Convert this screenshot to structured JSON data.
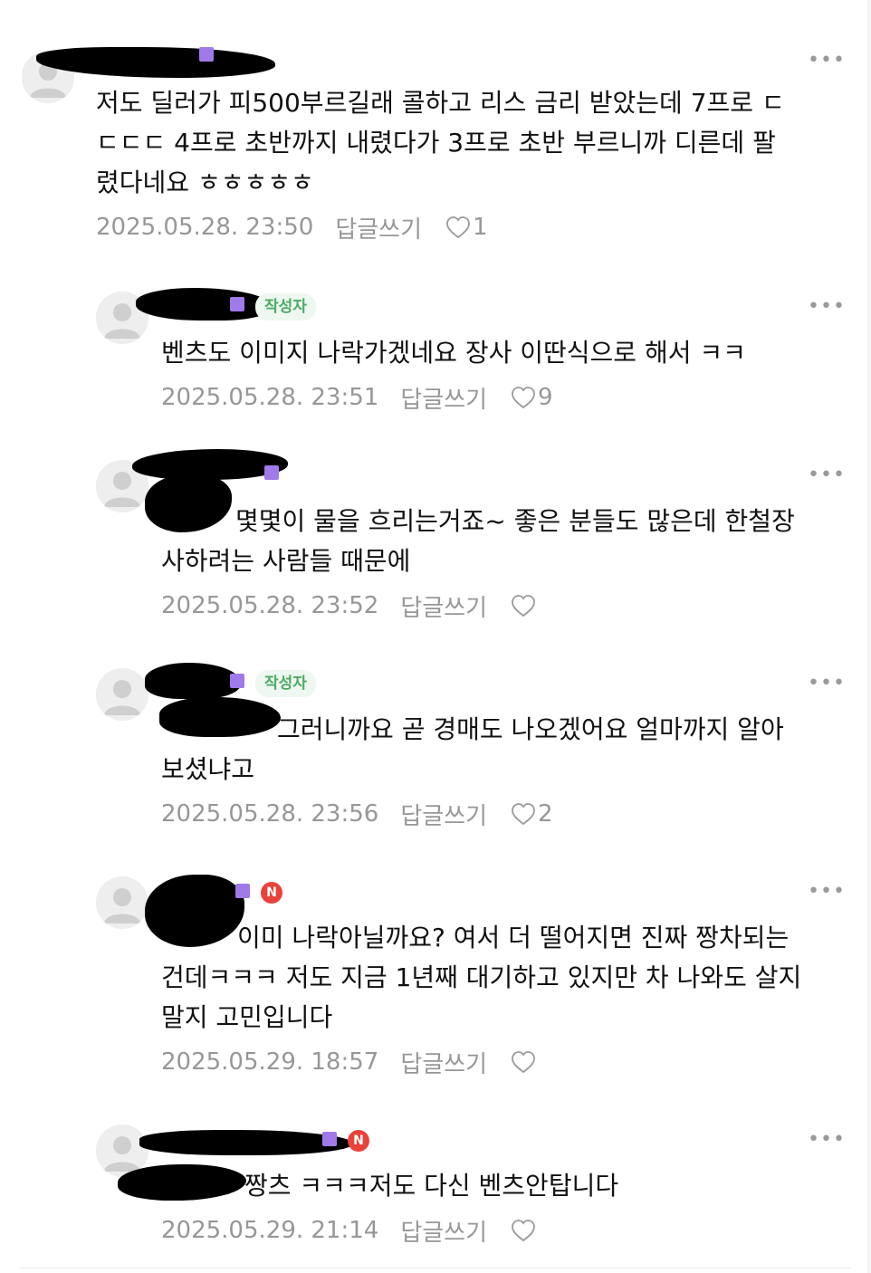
{
  "icons": {
    "avatar": "default-user-avatar",
    "more": "more-horizontal-icon",
    "like": "heart-outline-icon"
  },
  "colors": {
    "author_badge_bg": "#eef8f0",
    "author_badge_text": "#4caa63",
    "new_badge": "#e8423b",
    "meta_text": "#979797"
  },
  "more_glyph": "•••",
  "comments": [
    {
      "text": "저도 딜러가 피500부르길래 콜하고 리스 금리 받았는데 7프로 ㄷ\nㄷㄷㄷ 4프로 초반까지 내렸다가 3프로 초반 부르니까 디른데 팔\n렸다네요 ㅎㅎㅎㅎㅎ",
      "date": "2025.05.28. 23:50",
      "reply": "답글쓰기",
      "likes": "1"
    },
    {
      "badge": "작성자",
      "text": "벤츠도 이미지 나락가겠네요 장사 이딴식으로 해서 ㅋㅋ",
      "date": "2025.05.28. 23:51",
      "reply": "답글쓰기",
      "likes": "9"
    },
    {
      "text": "몇몇이 물을 흐리는거죠~ 좋은 분들도 많은데 한철장\n사하려는 사람들 때문에",
      "date": "2025.05.28. 23:52",
      "reply": "답글쓰기",
      "likes": ""
    },
    {
      "badge": "작성자",
      "text": "그러니까요 곧 경매도 나오겠어요 얼마까지 알아\n보셨냐고",
      "date": "2025.05.28. 23:56",
      "reply": "답글쓰기",
      "likes": "2"
    },
    {
      "new_badge": "N",
      "text": "이미 나락아닐까요? 여서 더 떨어지면 진짜 짱차되는\n건데ㅋㅋㅋ 저도 지금 1년째 대기하고 있지만 차 나와도 살지\n말지 고민입니다",
      "date": "2025.05.29. 18:57",
      "reply": "답글쓰기",
      "likes": ""
    },
    {
      "new_badge": "N",
      "text": "짱츠 ㅋㅋㅋ저도 다신 벤츠안탑니다",
      "date": "2025.05.29. 21:14",
      "reply": "답글쓰기",
      "likes": ""
    }
  ]
}
